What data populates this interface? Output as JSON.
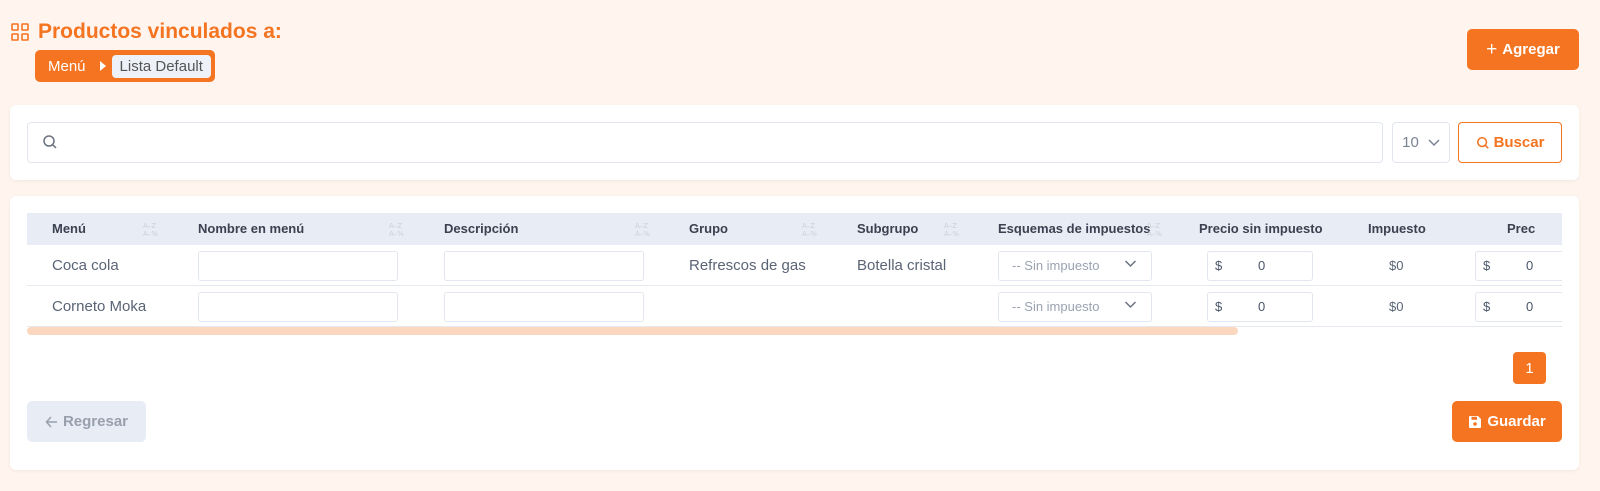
{
  "header": {
    "title": "Productos vinculados a:",
    "breadcrumb": {
      "first": "Menú",
      "current": "Lista Default"
    }
  },
  "toolbar": {
    "add_label": "Agregar"
  },
  "search": {
    "value": "",
    "placeholder": "",
    "page_size": "10",
    "button_label": "Buscar"
  },
  "table": {
    "columns": [
      "Menú",
      "Nombre en menú",
      "Descripción",
      "Grupo",
      "Subgrupo",
      "Esquemas de impuestos",
      "Precio sin impuesto",
      "Impuesto",
      "Prec"
    ],
    "rows": [
      {
        "menu": "Coca cola",
        "nombre": "",
        "descripcion": "",
        "grupo": "Refrescos de gas",
        "subgrupo": "Botella cristal",
        "esquema": "-- Sin impuesto",
        "currency": "$",
        "precio_sin": "0",
        "impuesto": "$0",
        "precio": "0"
      },
      {
        "menu": "Corneto Moka",
        "nombre": "",
        "descripcion": "",
        "grupo": "",
        "subgrupo": "",
        "esquema": "-- Sin impuesto",
        "currency": "$",
        "precio_sin": "0",
        "impuesto": "$0",
        "precio": "0"
      }
    ]
  },
  "pagination": {
    "current": "1"
  },
  "footer": {
    "back_label": "Regresar",
    "save_label": "Guardar"
  },
  "colors": {
    "accent": "#f47421",
    "background": "#fff4ee",
    "header_row": "#e8ecf4"
  }
}
